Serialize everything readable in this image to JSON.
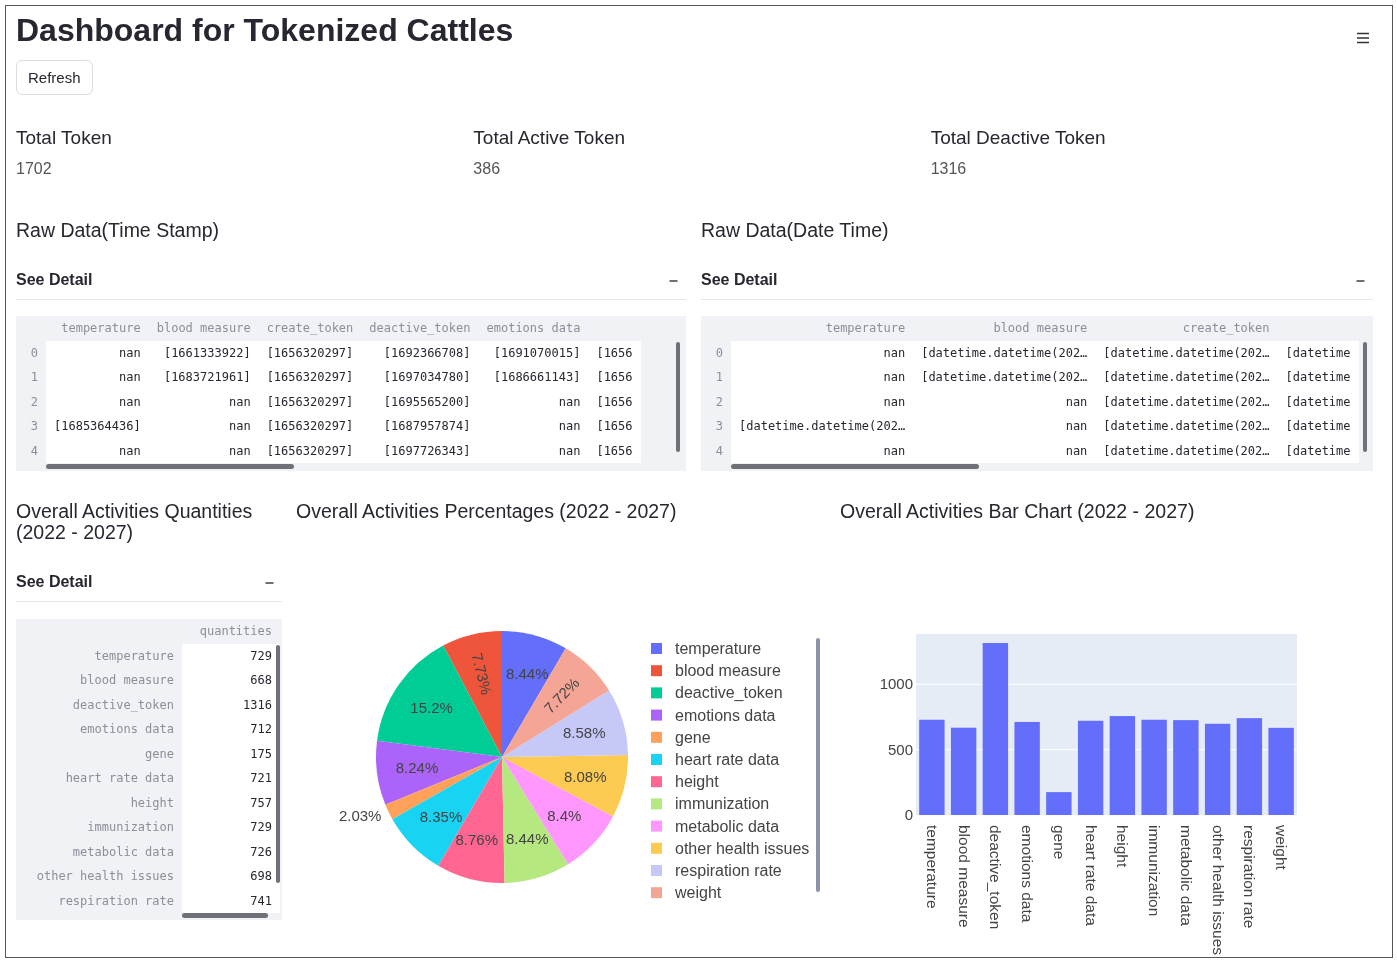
{
  "title": "Dashboard for Tokenized Cattles",
  "refresh_button": "Refresh",
  "metrics": [
    {
      "label": "Total Token",
      "value": "1702"
    },
    {
      "label": "Total Active Token",
      "value": "386"
    },
    {
      "label": "Total Deactive Token",
      "value": "1316"
    }
  ],
  "raw_sections": [
    {
      "title": "Raw Data(Time Stamp)",
      "expander": {
        "label": "See Detail",
        "expanded": true
      },
      "table": {
        "columns": [
          "temperature",
          "blood measure",
          "create_token",
          "deactive_token",
          "emotions data"
        ],
        "rows": [
          {
            "index": "0",
            "cells": [
              "nan",
              "[1661333922]",
              "[1656320297]",
              "[1692366708]",
              "[1691070015]",
              "[1656"
            ]
          },
          {
            "index": "1",
            "cells": [
              "nan",
              "[1683721961]",
              "[1656320297]",
              "[1697034780]",
              "[1686661143]",
              "[1656"
            ]
          },
          {
            "index": "2",
            "cells": [
              "nan",
              "nan",
              "[1656320297]",
              "[1695565200]",
              "nan",
              "[1656"
            ]
          },
          {
            "index": "3",
            "cells": [
              "[1685364436]",
              "nan",
              "[1656320297]",
              "[1687957874]",
              "nan",
              "[1656"
            ]
          },
          {
            "index": "4",
            "cells": [
              "nan",
              "nan",
              "[1656320297]",
              "[1697726343]",
              "nan",
              "[1656"
            ]
          }
        ]
      }
    },
    {
      "title": "Raw Data(Date Time)",
      "expander": {
        "label": "See Detail",
        "expanded": true
      },
      "table": {
        "columns": [
          "temperature",
          "blood measure",
          "create_token"
        ],
        "rows": [
          {
            "index": "0",
            "cells": [
              "nan",
              "[datetime.datetime(202…",
              "[datetime.datetime(202…",
              "[datetime"
            ]
          },
          {
            "index": "1",
            "cells": [
              "nan",
              "[datetime.datetime(202…",
              "[datetime.datetime(202…",
              "[datetime"
            ]
          },
          {
            "index": "2",
            "cells": [
              "nan",
              "nan",
              "[datetime.datetime(202…",
              "[datetime"
            ]
          },
          {
            "index": "3",
            "cells": [
              "[datetime.datetime(202…",
              "nan",
              "[datetime.datetime(202…",
              "[datetime"
            ]
          },
          {
            "index": "4",
            "cells": [
              "nan",
              "nan",
              "[datetime.datetime(202…",
              "[datetime"
            ]
          }
        ]
      }
    }
  ],
  "quantities_section": {
    "title": "Overall Activities Quantities (2022 - 2027)",
    "expander": {
      "label": "See Detail",
      "expanded": true
    },
    "table": {
      "columns": [
        "quantities"
      ],
      "rows": [
        {
          "index": "temperature",
          "cells": [
            "729"
          ]
        },
        {
          "index": "blood measure",
          "cells": [
            "668"
          ]
        },
        {
          "index": "deactive_token",
          "cells": [
            "1316"
          ]
        },
        {
          "index": "emotions data",
          "cells": [
            "712"
          ]
        },
        {
          "index": "gene",
          "cells": [
            "175"
          ]
        },
        {
          "index": "heart rate data",
          "cells": [
            "721"
          ]
        },
        {
          "index": "height",
          "cells": [
            "757"
          ]
        },
        {
          "index": "immunization",
          "cells": [
            "729"
          ]
        },
        {
          "index": "metabolic data",
          "cells": [
            "726"
          ]
        },
        {
          "index": "other health issues",
          "cells": [
            "698"
          ]
        },
        {
          "index": "respiration rate",
          "cells": [
            "741"
          ]
        }
      ]
    }
  },
  "pie_section": {
    "title": "Overall Activities Percentages (2022 - 2027)",
    "chart_data": {
      "type": "pie",
      "categories": [
        "temperature",
        "blood measure",
        "deactive_token",
        "emotions data",
        "gene",
        "heart rate data",
        "height",
        "immunization",
        "metabolic data",
        "other health issues",
        "respiration rate",
        "weight"
      ],
      "values": [
        8.44,
        7.73,
        15.2,
        8.24,
        2.03,
        8.35,
        8.76,
        8.44,
        8.4,
        8.08,
        8.58,
        7.72
      ],
      "legend": true,
      "colors": [
        "#636efa",
        "#ef553b",
        "#00cc96",
        "#ab63fa",
        "#ffa15a",
        "#19d3f3",
        "#ff6692",
        "#b6e880",
        "#ff97ff",
        "#fecb52",
        "#c6c9f8",
        "#f4a596"
      ],
      "value_labels": [
        "8.44%",
        "7.73%",
        "15.2%",
        "8.24%",
        "2.03%",
        "8.35%",
        "8.76%",
        "8.44%",
        "8.4%",
        "8.08%",
        "8.58%",
        "7.72%"
      ]
    }
  },
  "bar_section": {
    "title": "Overall Activities Bar Chart (2022 - 2027)",
    "chart_data": {
      "type": "bar",
      "categories": [
        "temperature",
        "blood measure",
        "deactive_token",
        "emotions data",
        "gene",
        "heart rate data",
        "height",
        "immunization",
        "metabolic data",
        "other health issues",
        "respiration rate",
        "weight"
      ],
      "series": [
        {
          "color": "#636efa",
          "values": [
            729,
            668,
            1316,
            712,
            175,
            721,
            757,
            729,
            726,
            698,
            741,
            667
          ]
        }
      ],
      "ylim": [
        0,
        1385
      ],
      "yticks": [
        {
          "value": 0,
          "label": "0"
        },
        {
          "value": 500,
          "label": "500"
        },
        {
          "value": 1000,
          "label": "1000"
        }
      ]
    }
  }
}
